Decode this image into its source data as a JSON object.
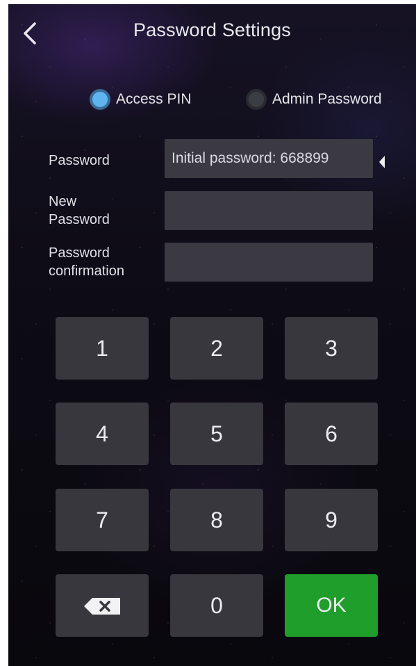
{
  "header": {
    "title": "Password Settings",
    "back_icon": "chevron-left-icon"
  },
  "mode": {
    "options": [
      {
        "label": "Access PIN",
        "selected": true
      },
      {
        "label": "Admin Password",
        "selected": false
      }
    ]
  },
  "form": {
    "password_label": "Password",
    "password_value": "Initial password: 668899",
    "new_password_label_line1": "New",
    "new_password_label_line2": "Password",
    "new_password_value": "",
    "confirm_label_line1": "Password",
    "confirm_label_line2": "confirmation",
    "confirm_value": ""
  },
  "keypad": {
    "k1": "1",
    "k2": "2",
    "k3": "3",
    "k4": "4",
    "k5": "5",
    "k6": "6",
    "k7": "7",
    "k8": "8",
    "k9": "9",
    "k0": "0",
    "ok": "OK",
    "backspace_icon": "backspace-icon"
  },
  "colors": {
    "accent_radio": "#5fb4f0",
    "ok_button": "#1f9e2c",
    "field_bg": "#3b3a42",
    "key_bg": "#38373e"
  }
}
